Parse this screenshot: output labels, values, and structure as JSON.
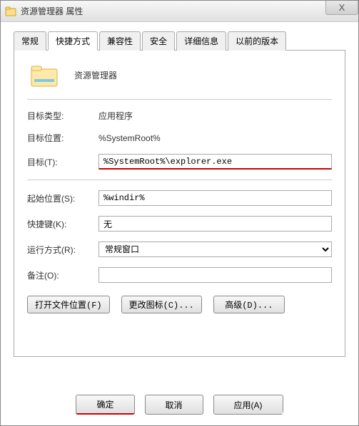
{
  "titlebar": {
    "title": "资源管理器 属性",
    "close": "X"
  },
  "tabs": {
    "general": "常规",
    "shortcut": "快捷方式",
    "compat": "兼容性",
    "security": "安全",
    "details": "详细信息",
    "previous": "以前的版本"
  },
  "app": {
    "name": "资源管理器"
  },
  "fields": {
    "target_type_label": "目标类型:",
    "target_type_value": "应用程序",
    "target_location_label": "目标位置:",
    "target_location_value": "%SystemRoot%",
    "target_label": "目标(T):",
    "target_value": "%SystemRoot%\\explorer.exe",
    "start_in_label": "起始位置(S):",
    "start_in_value": "%windir%",
    "shortcut_key_label": "快捷键(K):",
    "shortcut_key_value": "无",
    "run_label": "运行方式(R):",
    "run_value": "常规窗口",
    "comment_label": "备注(O):",
    "comment_value": ""
  },
  "buttons": {
    "open_location": "打开文件位置(F)",
    "change_icon": "更改图标(C)...",
    "advanced": "高级(D)...",
    "ok": "确定",
    "cancel": "取消",
    "apply": "应用(A)"
  }
}
